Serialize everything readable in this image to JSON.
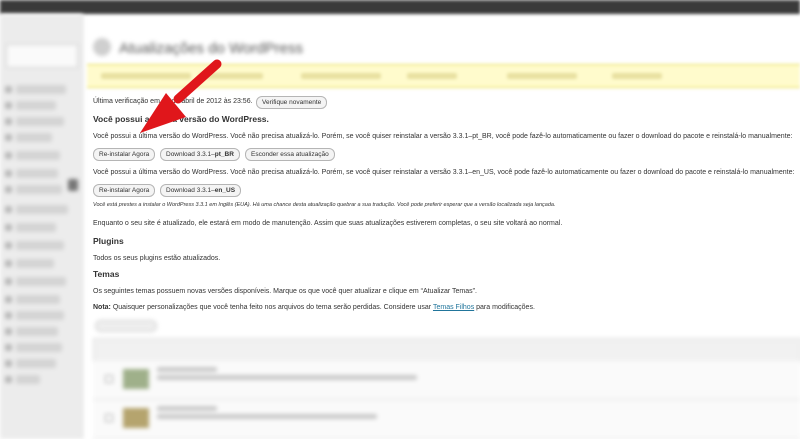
{
  "page": {
    "title": "Atualizações do WordPress"
  },
  "core": {
    "last_checked": "Última verificação em 18 de abril de 2012 às 23:56.",
    "check_again": "Verifique novamente",
    "heading": "Você possui a última versão do WordPress.",
    "pt_br_text": "Você possui a última versão do WordPress. Você não precisa atualizá-lo. Porém, se você quiser reinstalar a versão 3.3.1–pt_BR, você pode fazê-lo automaticamente ou fazer o download do pacote e reinstalá-lo manualmente:",
    "pt_br_buttons": {
      "reinstall": "Re-instalar Agora",
      "download_prefix": "Download 3.3.1–",
      "download_locale": "pt_BR",
      "hide": "Esconder essa atualização"
    },
    "en_us_text": "Você possui a última versão do WordPress. Você não precisa atualizá-lo. Porém, se você quiser reinstalar a versão 3.3.1–en_US, você pode fazê-lo automaticamente ou fazer o download do pacote e reinstalá-lo manualmente:",
    "en_us_buttons": {
      "reinstall": "Re-instalar Agora",
      "download_prefix": "Download 3.3.1–",
      "download_locale": "en_US"
    },
    "en_us_note": "Você está prestes a instalar o WordPress 3.3.1 em Inglês (EUA). Há uma chance desta atualização quebrar a sua tradução. Você pode preferir esperar que a versão localizada seja lançada.",
    "maintenance": "Enquanto o seu site é atualizado, ele estará em modo de manutenção. Assim que suas atualizações estiverem completas, o seu site voltará ao normal."
  },
  "plugins": {
    "heading": "Plugins",
    "text": "Todos os seus plugins estão atualizados."
  },
  "themes": {
    "heading": "Temas",
    "text": "Os seguintes temas possuem novas versões disponíveis. Marque os que você quer atualizar e clique em “Atualizar Temas”.",
    "note_label": "Nota:",
    "note_text": " Quaisquer personalizações que você tenha feito nos arquivos do tema serão perdidas. Considere usar ",
    "note_link": "Temas Filhos",
    "note_end": " para modificações."
  },
  "colors": {
    "arrow": "#e0161b",
    "link": "#21759b",
    "notice_bg": "#fffbcc"
  },
  "icons": [
    "arrow-annotation",
    "updates-icon"
  ]
}
